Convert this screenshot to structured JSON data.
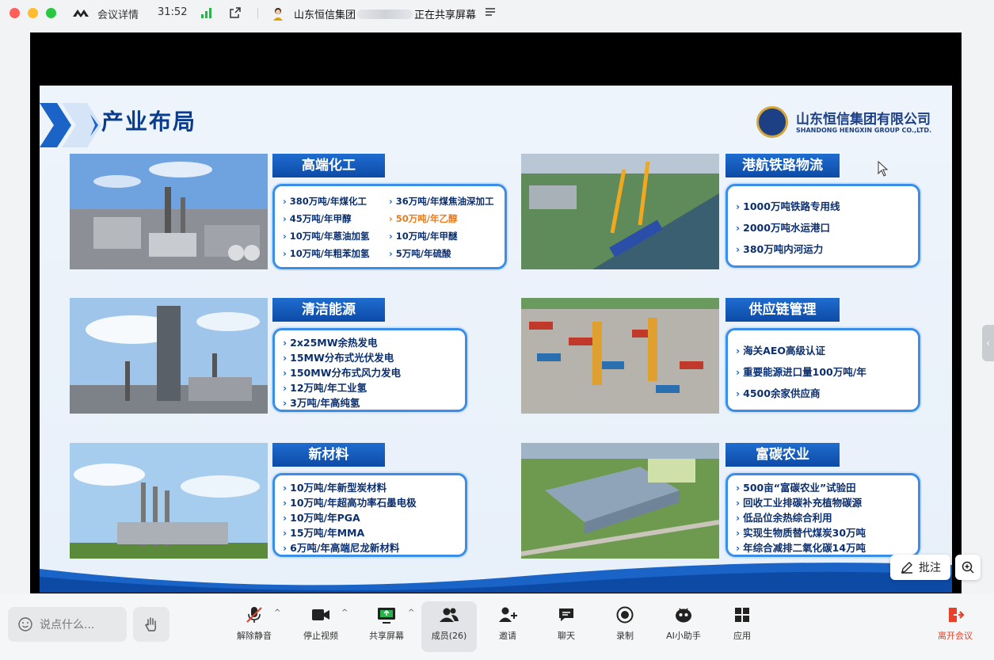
{
  "titlebar": {
    "details": "会议详情",
    "time": "31:52",
    "share_prefix": "山东恒信集团",
    "share_suffix": "正在共享屏幕"
  },
  "slide": {
    "title": "产业布局",
    "company_cn": "山东恒信集团有限公司",
    "company_en": "SHANDONG HENGXIN GROUP CO.,LTD.",
    "sections": {
      "chem": {
        "label": "高端化工",
        "items": [
          "380万吨/年煤化工",
          "36万吨/年煤焦油深加工",
          "45万吨/年甲醇",
          "50万吨/年乙醇",
          "10万吨/年蒽油加氢",
          "10万吨/年甲醚",
          "10万吨/年粗苯加氢",
          "5万吨/年硫酸"
        ]
      },
      "energy": {
        "label": "清洁能源",
        "items": [
          "2x25MW余热发电",
          "15MW分布式光伏发电",
          "150MW分布式风力发电",
          "12万吨/年工业氢",
          "3万吨/年高纯氢"
        ]
      },
      "material": {
        "label": "新材料",
        "items": [
          "10万吨/年新型炭材料",
          "10万吨/年超高功率石墨电极",
          "10万吨/年PGA",
          "15万吨/年MMA",
          "6万吨/年高端尼龙新材料"
        ]
      },
      "logistics": {
        "label": "港航铁路物流",
        "items": [
          "1000万吨铁路专用线",
          "2000万吨水运港口",
          "380万吨内河运力"
        ]
      },
      "supply": {
        "label": "供应链管理",
        "items": [
          "海关AEO高级认证",
          "重要能源进口量100万吨/年",
          "4500余家供应商"
        ]
      },
      "agri": {
        "label": "富碳农业",
        "items": [
          "500亩“富碳农业”试验田",
          "回收工业排碳补充植物碳源",
          "低品位余热综合利用",
          "实现生物质替代煤炭30万吨",
          "年综合减排二氧化碳14万吨"
        ]
      }
    }
  },
  "annotate_label": "批注",
  "toolbar": {
    "say_placeholder": "说点什么...",
    "unmute": "解除静音",
    "stop_video": "停止视频",
    "share_screen": "共享屏幕",
    "members": "成员(26)",
    "invite": "邀请",
    "chat": "聊天",
    "record": "录制",
    "ai_assistant": "AI小助手",
    "apps": "应用",
    "leave": "离开会议"
  },
  "colors": {
    "accent_blue": "#0d4aa6",
    "leave_red": "#e8402a",
    "highlight_orange": "#e87b20"
  }
}
